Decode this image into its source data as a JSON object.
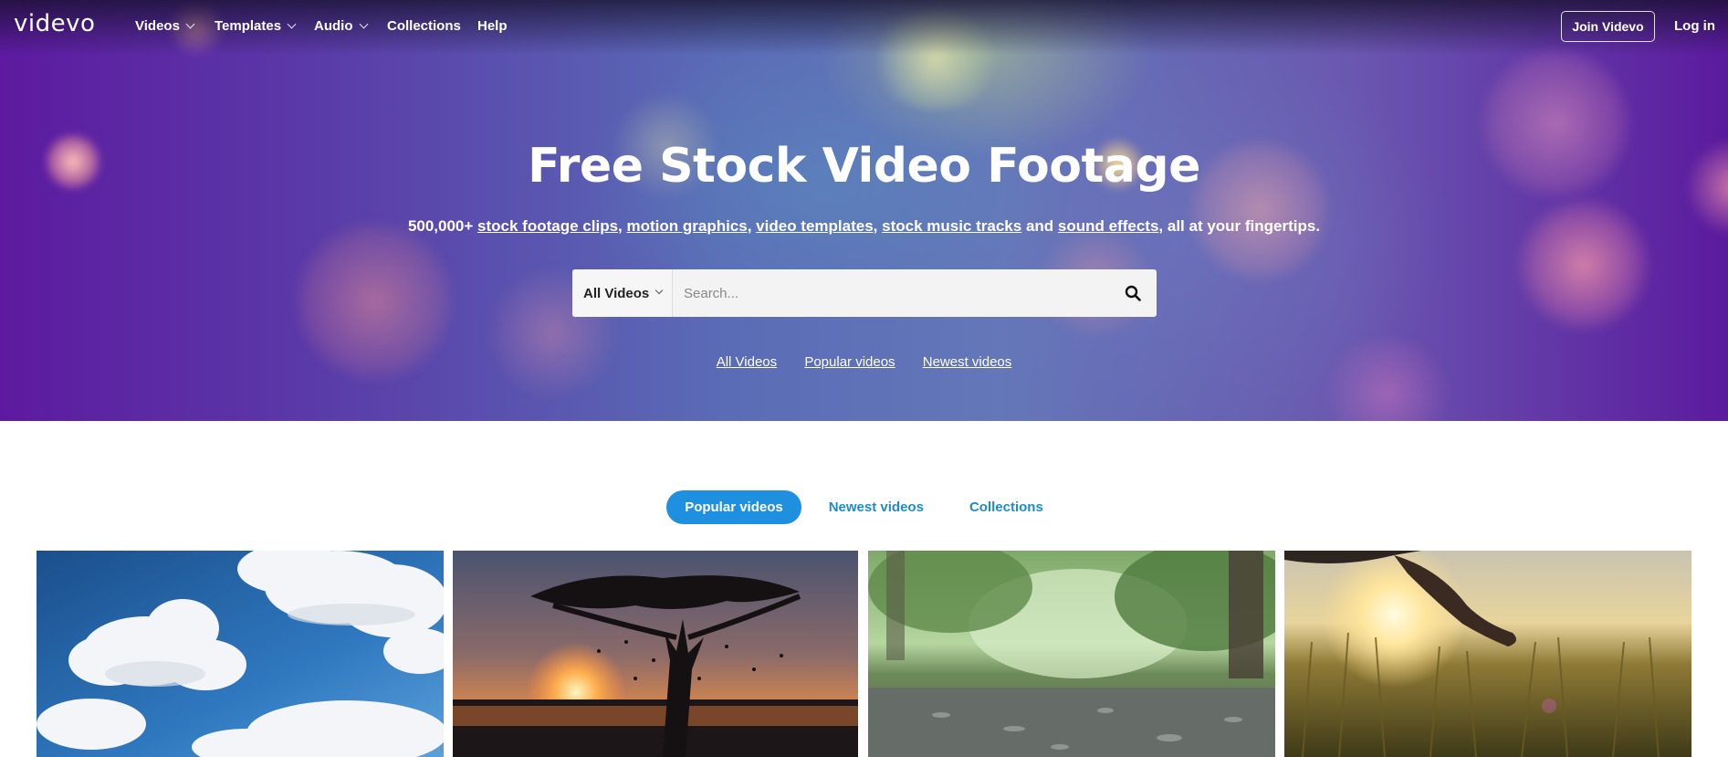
{
  "brand": {
    "logo": "videvo"
  },
  "nav": {
    "items": [
      {
        "label": "Videos",
        "dropdown": true
      },
      {
        "label": "Templates",
        "dropdown": true
      },
      {
        "label": "Audio",
        "dropdown": true
      },
      {
        "label": "Collections",
        "dropdown": false
      },
      {
        "label": "Help",
        "dropdown": false
      }
    ],
    "join_label": "Join Videvo",
    "login_label": "Log in"
  },
  "hero": {
    "title": "Free Stock Video Footage",
    "subtitle": {
      "prefix": "500,000+ ",
      "links": [
        "stock footage clips",
        "motion graphics",
        "video templates",
        "stock music tracks",
        "sound effects"
      ],
      "and": " and ",
      "suffix": ", all at your fingertips."
    },
    "search": {
      "category": "All Videos",
      "placeholder": "Search...",
      "icon": "search-icon"
    },
    "quick_links": [
      "All Videos",
      "Popular videos",
      "Newest videos"
    ]
  },
  "tabs": [
    {
      "label": "Popular videos",
      "active": true
    },
    {
      "label": "Newest videos",
      "active": false
    },
    {
      "label": "Collections",
      "active": false
    }
  ],
  "thumbnails": [
    {
      "subject": "clouds-blue-sky"
    },
    {
      "subject": "acacia-tree-sunset"
    },
    {
      "subject": "rain-puddle-forest"
    },
    {
      "subject": "hand-wheat-field-sunset"
    }
  ],
  "colors": {
    "accent": "#1f8fe0",
    "tab_link": "#1f8bc7",
    "hero_purple": "#5d1aa0"
  }
}
